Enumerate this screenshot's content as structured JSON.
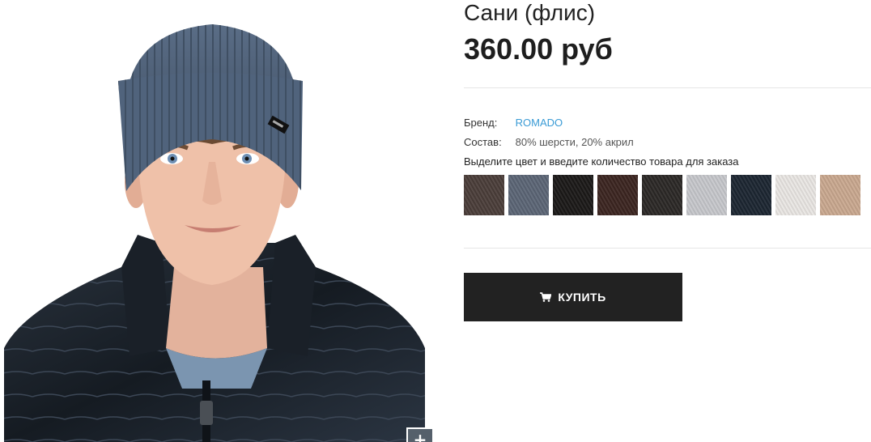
{
  "product": {
    "title": "Сани (флис)",
    "price": "360.00 руб",
    "brand_label": "Бренд:",
    "brand_value": "ROMADO",
    "composition_label": "Состав:",
    "composition_value": "80% шерсти, 20% акрил",
    "color_hint": "Выделите цвет и введите количество товара для заказа",
    "buy_label": "КУПИТЬ",
    "zoom_label": "+"
  },
  "swatches": [
    {
      "color": "#4a3d39"
    },
    {
      "color": "#5b6575"
    },
    {
      "color": "#1b1918"
    },
    {
      "color": "#3b2520"
    },
    {
      "color": "#2b2826"
    },
    {
      "color": "#c6c7cb"
    },
    {
      "color": "#1c2631"
    },
    {
      "color": "#e9e6e3"
    },
    {
      "color": "#c9a88f"
    }
  ],
  "colors": {
    "accent_link": "#3a9bd5",
    "button_bg": "#222222",
    "hat": "#4f6179",
    "jacket": "#1f2630"
  },
  "icons": {
    "cart": "cart-icon",
    "zoom": "plus-icon"
  }
}
